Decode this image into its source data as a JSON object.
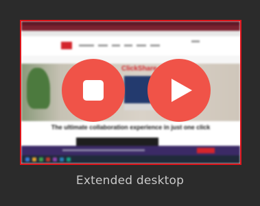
{
  "thumbnail": {
    "site_brand": "ClickShare",
    "tagline": "The ultimate collaboration experience in just one click",
    "border_color": "#e0141b"
  },
  "controls": {
    "stop_icon": "stop-icon",
    "play_icon": "play-icon",
    "button_color": "#f05348"
  },
  "mode": {
    "label": "Extended desktop"
  }
}
